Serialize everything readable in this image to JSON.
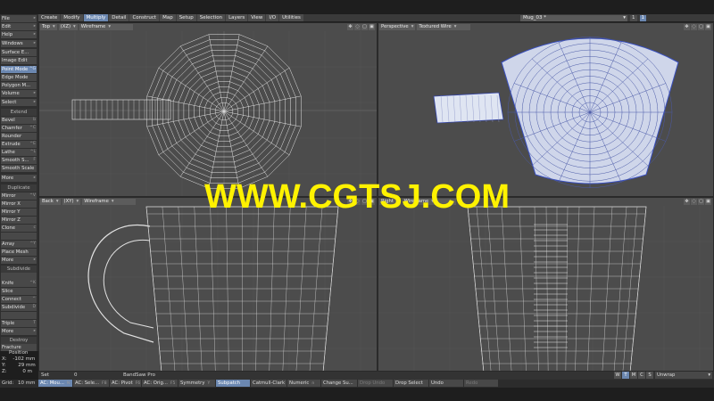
{
  "menu_tabs": [
    "Create",
    "Modify",
    "Multiply",
    "Detail",
    "Construct",
    "Map",
    "Setup",
    "Selection",
    "Layers",
    "View",
    "I/O",
    "Utilities"
  ],
  "active_tab": "Multiply",
  "scene": {
    "name": "Mug_03 *"
  },
  "top_counters": [
    "1",
    "1"
  ],
  "sidebar": {
    "file": "File",
    "edit": "Edit",
    "help": "Help",
    "windows": "Windows",
    "surface_editor": "Surface E...",
    "image_editor": "Image Edit",
    "point_mode": "Point Mode",
    "point_mode_key": "^G",
    "edge_mode": "Edge Mode",
    "polygon_mode": "Polygon M...",
    "volume": "Volume",
    "select": "Select",
    "extend_header": "Extend",
    "bevel": "Bevel",
    "bevel_key": "b",
    "chamfer": "Chamfer",
    "chamfer_key": "^C",
    "rounder": "Rounder",
    "extrude": "Extrude",
    "extrude_key": "^E",
    "lathe": "Lathe",
    "lathe_key": "^L",
    "smooth_shift": "Smooth S...",
    "smooth_shift_key": "F",
    "smooth_scale": "Smooth Scale",
    "more1": "More",
    "duplicate_header": "Duplicate",
    "mirror": "Mirror",
    "mirror_key": "^V",
    "mirror_x": "Mirror X",
    "mirror_y": "Mirror Y",
    "mirror_z": "Mirror Z",
    "clone": "Clone",
    "clone_key": "c",
    "array": "Array",
    "array_key": "^Y",
    "place_mesh": "Place Mesh",
    "more2": "More",
    "subdivide_header": "Subdivide",
    "knife": "Knife",
    "knife_key": "^K",
    "slice": "Slice",
    "connect": "Connect",
    "connect_key": "^",
    "subdivide": "Subdivide",
    "subdivide_key": "D",
    "triple": "Triple",
    "triple_key": "T",
    "more3": "More",
    "destroy_header": "Destroy",
    "fracture": "Fracture",
    "position_label": "Position",
    "pos_x_label": "X:",
    "pos_x": "-102 mm",
    "pos_y_label": "Y:",
    "pos_y": "29 mm",
    "pos_z_label": "Z:",
    "pos_z": "0 m"
  },
  "viewports": {
    "top_left": {
      "view": "Top",
      "axes": "(XZ)",
      "mode": "Wireframe"
    },
    "top_right": {
      "view": "Perspective",
      "mode": "Textured Wire"
    },
    "bottom_left": {
      "view": "Back",
      "axes": "(XY)",
      "mode": "Wireframe"
    },
    "bottom_right": {
      "view": "Right",
      "mode": "Wireframe"
    }
  },
  "watermark": "WWW.CGTSJ.COM",
  "status_bar": {
    "set_label": "Set",
    "set_value": "0",
    "plugin": "BandSaw Pro",
    "wtmcs": [
      "W",
      "T",
      "M",
      "C",
      "S"
    ],
    "wtmcs_active": [
      "T"
    ],
    "uv_map": "Unwrap"
  },
  "bottom_bar": {
    "grid_label": "Grid:",
    "grid_value": "10 mm",
    "ac_mouse": "AC: Mou...",
    "ac_mouse_key": "N",
    "ac_selection": "AC: Sele...",
    "ac_selection_key": "F8",
    "ac_pivot": "AC: Pivot",
    "ac_pivot_key": "F6",
    "ac_origin": "AC: Orig...",
    "ac_origin_key": "F5",
    "symmetry": "Symmetry",
    "symmetry_key": "Y",
    "subpatch": "Subpatch",
    "catmull": "Catmull-Clark",
    "numeric": "Numeric",
    "numeric_key": "n",
    "change_surface": "Change Su...",
    "drop_undo": "Drop Undo",
    "drop_select": "Drop Select",
    "undo": "Undo",
    "redo": "Redo"
  }
}
